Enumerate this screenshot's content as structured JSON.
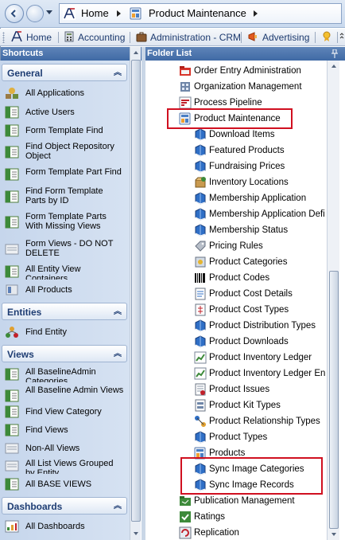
{
  "address_bar": {
    "crumbs": [
      "Home",
      "Product Maintenance"
    ]
  },
  "toolbar": {
    "items": [
      "Home",
      "Accounting",
      "Administration - CRM",
      "Advertising"
    ]
  },
  "shortcuts": {
    "title": "Shortcuts",
    "groups": [
      {
        "label": "General",
        "items": [
          "All Applications",
          "Active Users",
          "Form Template Find",
          "Find Object Repository Object",
          "Form Template Part Find",
          "Find Form Template Parts by ID",
          "Form Template Parts With Missing Views",
          "Form Views - DO NOT DELETE",
          "All Entity View Containers",
          "All Products"
        ]
      },
      {
        "label": "Entities",
        "items": [
          "Find Entity"
        ]
      },
      {
        "label": "Views",
        "items": [
          "All BaselineAdmin Categories",
          "All Baseline Admin Views",
          "Find View Category",
          "Find Views",
          "Non-All Views",
          "All List Views Grouped by Entity",
          "All BASE VIEWS"
        ]
      },
      {
        "label": "Dashboards",
        "items": [
          "All Dashboards"
        ]
      }
    ]
  },
  "folder_list": {
    "title": "Folder List",
    "items": [
      "Order Entry Administration",
      "Organization Management",
      "Process Pipeline",
      "Product Maintenance",
      "Download Items",
      "Featured Products",
      "Fundraising Prices",
      "Inventory Locations",
      "Membership Application",
      "Membership Application Defi",
      "Membership Status",
      "Pricing Rules",
      "Product Categories",
      "Product Codes",
      "Product Cost Details",
      "Product Cost Types",
      "Product Distribution Types",
      "Product Downloads",
      "Product Inventory Ledger",
      "Product Inventory Ledger En",
      "Product Issues",
      "Product Kit Types",
      "Product Relationship Types",
      "Product Types",
      "Products",
      "Sync Image Categories",
      "Sync Image Records",
      "Publication Management",
      "Ratings",
      "Replication"
    ]
  },
  "colors": {
    "pane_header": "#4b74ad",
    "highlight_border": "#d01020",
    "group_header_text": "#1e3d73"
  }
}
